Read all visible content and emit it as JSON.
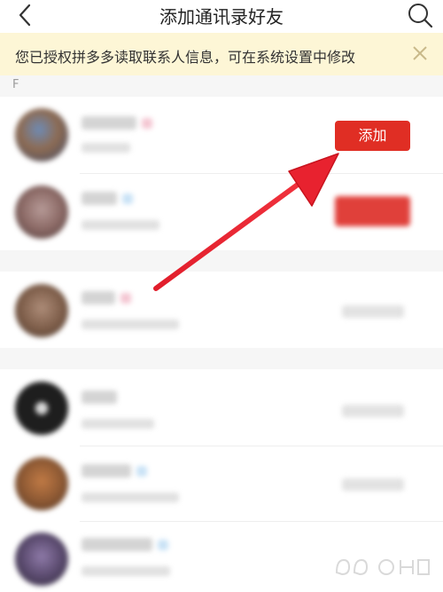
{
  "header": {
    "title": "添加通讯录好友",
    "back_icon": "back-chevron-icon",
    "search_icon": "search-icon"
  },
  "notice": {
    "text": "您已授权拼多多读取联系人信息，可在系统设置中修改",
    "close_icon": "close-icon"
  },
  "section": {
    "letter": "F"
  },
  "contacts": {
    "first": {
      "button_label": "添加"
    }
  },
  "colors": {
    "accent_red": "#e02e24",
    "notice_bg": "#fdf6d6"
  }
}
